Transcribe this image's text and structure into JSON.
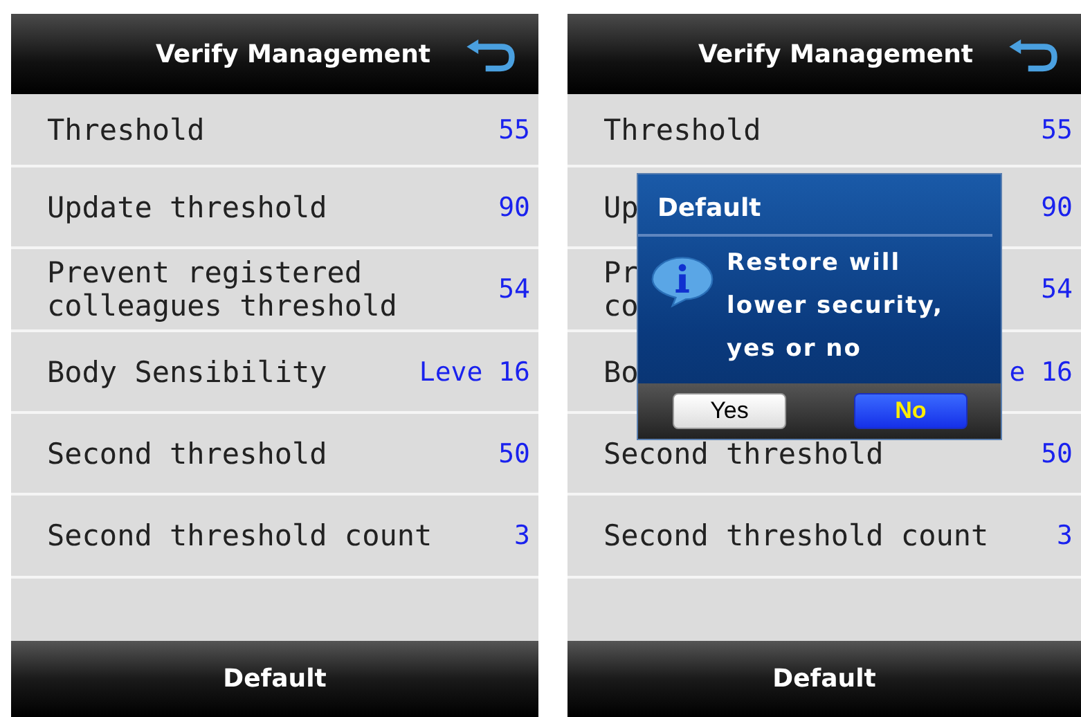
{
  "screens": [
    {
      "title": "Verify Management",
      "rows": [
        {
          "label": "Threshold",
          "value": "55"
        },
        {
          "label": "Update threshold",
          "value": "90"
        },
        {
          "label": "Prevent registered\ncolleagues threshold",
          "value": "54"
        },
        {
          "label": "Body Sensibility",
          "value": "Leve 16"
        },
        {
          "label": "Second threshold",
          "value": "50"
        },
        {
          "label": "Second threshold count",
          "value": "3"
        }
      ],
      "footer": "Default"
    },
    {
      "title": "Verify Management",
      "rows": [
        {
          "label": "Threshold",
          "value": "55"
        },
        {
          "label": "Up",
          "value": "90"
        },
        {
          "label": "Pr\nco",
          "value": "54"
        },
        {
          "label": "Bo",
          "value": "e 16"
        },
        {
          "label": "Second threshold",
          "value": "50"
        },
        {
          "label": "Second threshold count",
          "value": "3"
        }
      ],
      "footer": "Default",
      "dialog": {
        "title": "Default",
        "message": "Restore will\nlower security,\nyes or no",
        "buttons": [
          {
            "label": "Yes",
            "selected": false
          },
          {
            "label": "No",
            "selected": true
          }
        ]
      }
    }
  ]
}
